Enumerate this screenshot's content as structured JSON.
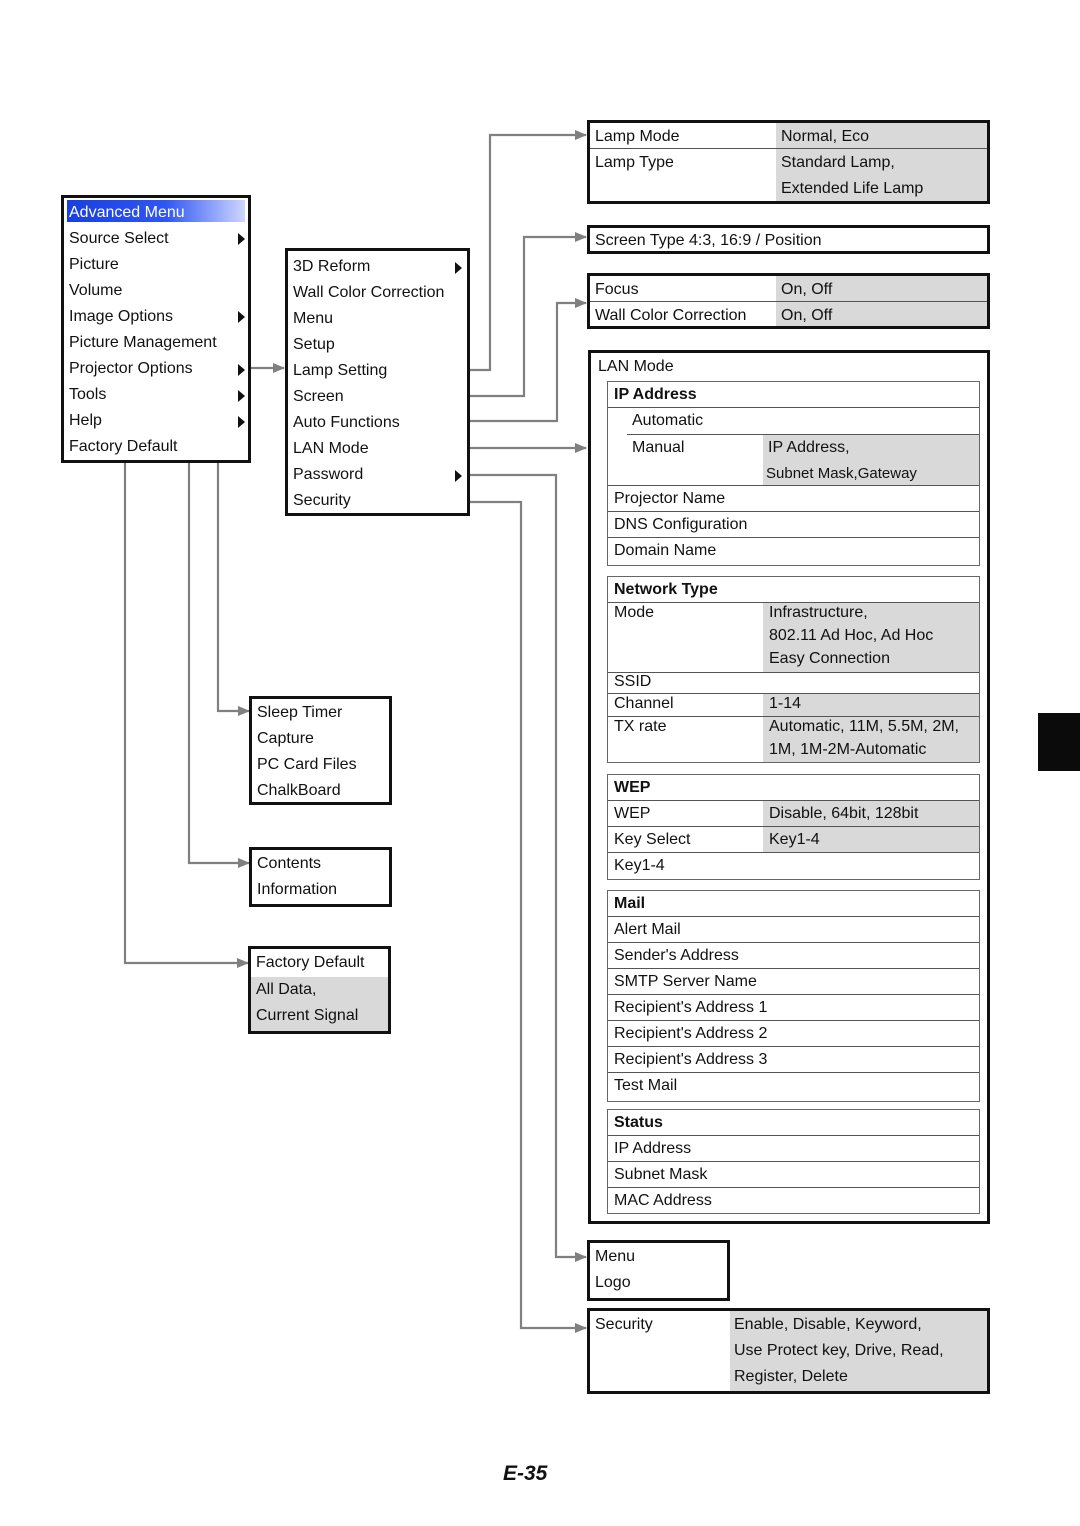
{
  "advanced_menu": {
    "title": "Advanced Menu",
    "items": [
      "Source Select",
      "Picture",
      "Volume",
      "Image Options",
      "Picture Management",
      "Projector Options",
      "Tools",
      "Help",
      "Factory Default"
    ]
  },
  "projector_options": {
    "items": [
      "3D Reform",
      "Wall Color Correction",
      "Menu",
      "Setup",
      "Lamp Setting",
      "Screen",
      "Auto Functions",
      "LAN Mode",
      "Password",
      "Security"
    ]
  },
  "lamp_setting": {
    "rows": [
      {
        "label": "Lamp Mode",
        "value": "Normal, Eco"
      },
      {
        "label": "Lamp Type",
        "value": "Standard Lamp,",
        "value2": "Extended Life Lamp"
      }
    ]
  },
  "screen": {
    "text": "Screen Type 4:3, 16:9 / Position"
  },
  "auto_functions": {
    "rows": [
      {
        "label": "Focus",
        "value": "On, Off"
      },
      {
        "label": "Wall Color Correction",
        "value": "On, Off"
      }
    ]
  },
  "lan_mode": {
    "title": "LAN Mode",
    "ip_address": {
      "header": "IP Address",
      "automatic": "Automatic",
      "manual": "Manual",
      "manual_value1": "IP Address,",
      "manual_value2": "Subnet Mask,Gateway",
      "rows": [
        "Projector Name",
        "DNS Configuration",
        "Domain Name"
      ]
    },
    "network_type": {
      "header": "Network Type",
      "mode_label": "Mode",
      "mode_values": [
        "Infrastructure,",
        "802.11 Ad Hoc, Ad Hoc",
        "Easy Connection"
      ],
      "ssid": "SSID",
      "channel_label": "Channel",
      "channel_value": "1-14",
      "tx_label": "TX rate",
      "tx_values": [
        "Automatic, 11M, 5.5M, 2M,",
        "1M, 1M-2M-Automatic"
      ]
    },
    "wep": {
      "header": "WEP",
      "wep_label": "WEP",
      "wep_value": "Disable, 64bit, 128bit",
      "key_select_label": "Key Select",
      "key_select_value": "Key1-4",
      "key_row": "Key1-4"
    },
    "mail": {
      "header": "Mail",
      "rows": [
        "Alert Mail",
        "Sender's Address",
        "SMTP Server Name",
        "Recipient's Address 1",
        "Recipient's Address 2",
        "Recipient's Address 3",
        "Test Mail"
      ]
    },
    "status": {
      "header": "Status",
      "rows": [
        "IP Address",
        "Subnet Mask",
        "MAC Address"
      ]
    }
  },
  "password": {
    "items": [
      "Menu",
      "Logo"
    ]
  },
  "security": {
    "label": "Security",
    "values": [
      "Enable, Disable, Keyword,",
      "Use Protect key, Drive, Read,",
      "Register, Delete"
    ]
  },
  "tools": {
    "items": [
      "Sleep Timer",
      "Capture",
      "PC Card Files",
      "ChalkBoard"
    ]
  },
  "help": {
    "items": [
      "Contents",
      "Information"
    ]
  },
  "factory_default": {
    "label": "Factory Default",
    "values": [
      "All Data,",
      "Current Signal"
    ]
  },
  "page_number": "E-35",
  "colors": {
    "highlight": "#1a3fe0",
    "value_cell": "#d9d9d9",
    "connector": "#808080"
  }
}
